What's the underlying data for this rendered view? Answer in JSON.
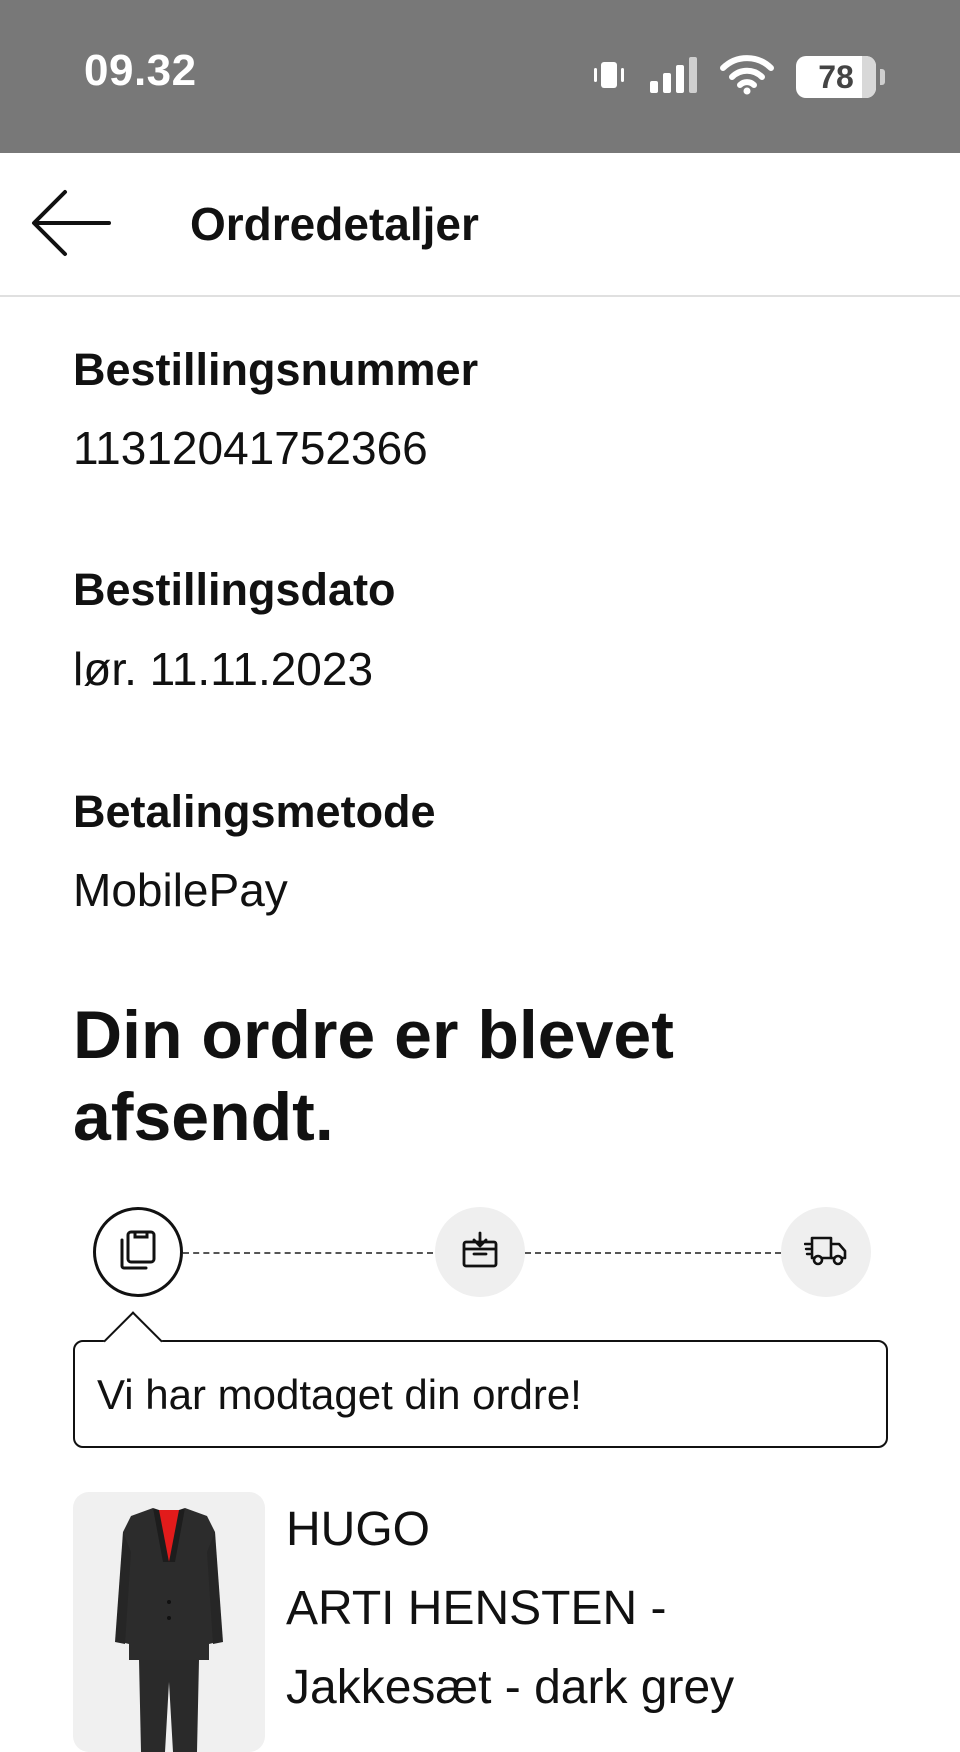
{
  "status_bar": {
    "time": "09.32",
    "battery": "78",
    "icons": [
      "vibrate-icon",
      "signal-icon",
      "wifi-icon",
      "battery-icon"
    ]
  },
  "header": {
    "back_icon": "arrow-left-icon",
    "title": "Ordredetaljer"
  },
  "order": {
    "number_label": "Bestillingsnummer",
    "number": "11312041752366",
    "date_label": "Bestillingsdato",
    "date": "lør. 11.11.2023",
    "payment_label": "Betalingsmetode",
    "payment": "MobilePay"
  },
  "status": {
    "headline": "Din ordre er blevet afsendt.",
    "steps": [
      {
        "icon": "order-received-icon",
        "active": true
      },
      {
        "icon": "package-icon",
        "active": false
      },
      {
        "icon": "delivery-truck-icon",
        "active": false
      }
    ],
    "message": "Vi har modtaget din ordre!"
  },
  "product": {
    "brand": "HUGO",
    "name": "ARTI HENSTEN -",
    "desc": "Jakkesæt - dark grey",
    "image_icon": "suit-image"
  },
  "colors": {
    "status_bar_bg": "#787878",
    "text": "#111111",
    "step_inactive_bg": "#efefef",
    "suit": "#2a2a2a",
    "suit_lining": "#e21b1b"
  }
}
